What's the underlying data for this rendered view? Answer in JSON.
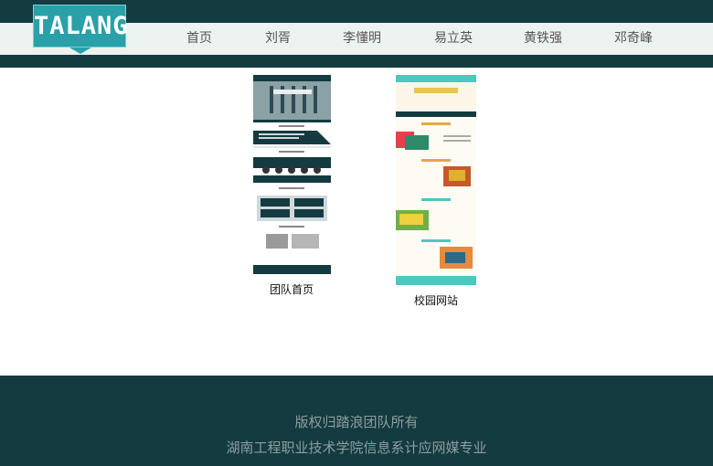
{
  "header": {
    "logo_text": "TALANG",
    "nav": [
      "首页",
      "刘胥",
      "李懂明",
      "易立英",
      "黄铁强",
      "邓奇峰"
    ]
  },
  "gallery": [
    {
      "caption": "团队首页"
    },
    {
      "caption": "校园网站"
    }
  ],
  "footer": {
    "line1": "版权归踏浪团队所有",
    "line2": "湖南工程职业技术学院信息系计应网媒专业"
  }
}
